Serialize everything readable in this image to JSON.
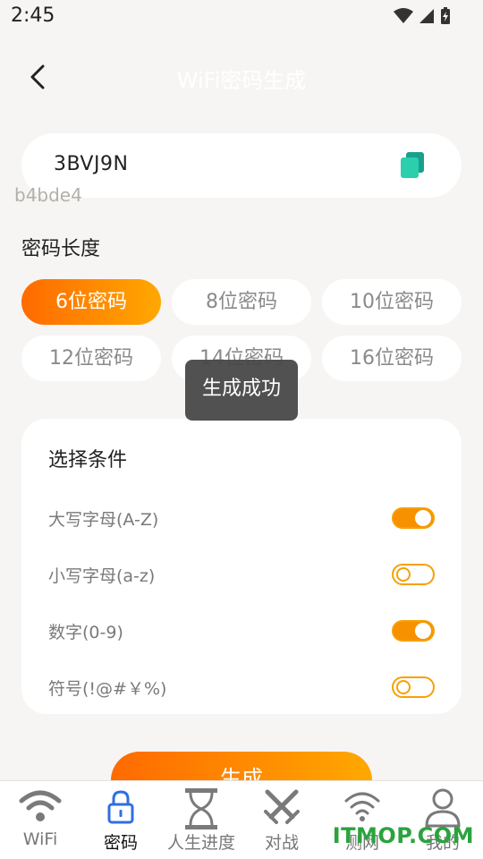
{
  "status": {
    "time": "2:45"
  },
  "header": {
    "title": "WiFi密码生成"
  },
  "password": {
    "value": "3BVJ9N",
    "hash": "b4bde4"
  },
  "length_section": {
    "label": "密码长度",
    "options": [
      "6位密码",
      "8位密码",
      "10位密码",
      "12位密码",
      "14位密码",
      "16位密码"
    ],
    "selected": "6位密码"
  },
  "toast": "生成成功",
  "conditions": {
    "title": "选择条件",
    "items": [
      {
        "label": "大写字母(A-Z)",
        "enabled": true
      },
      {
        "label": "小写字母(a-z)",
        "enabled": false
      },
      {
        "label": "数字(0-9)",
        "enabled": true
      },
      {
        "label": "符号(!@#￥%)",
        "enabled": false
      }
    ]
  },
  "generate_button": "生成",
  "tabbar": {
    "items": [
      {
        "label": "WiFi",
        "icon": "wifi-icon"
      },
      {
        "label": "密码",
        "icon": "lock-icon"
      },
      {
        "label": "人生进度",
        "icon": "hourglass-icon"
      },
      {
        "label": "对战",
        "icon": "crossed-swords-icon"
      },
      {
        "label": "测网",
        "icon": "wifi-signal-icon"
      },
      {
        "label": "我的",
        "icon": "user-icon"
      }
    ],
    "active": "密码"
  },
  "watermark": "ITMOP.COM",
  "colors": {
    "accent_start": "#ff6a00",
    "accent_end": "#ffa800",
    "background": "#f6f5f3",
    "copy_icon": "#2bcfae",
    "tab_active": "#2f6fe0"
  }
}
